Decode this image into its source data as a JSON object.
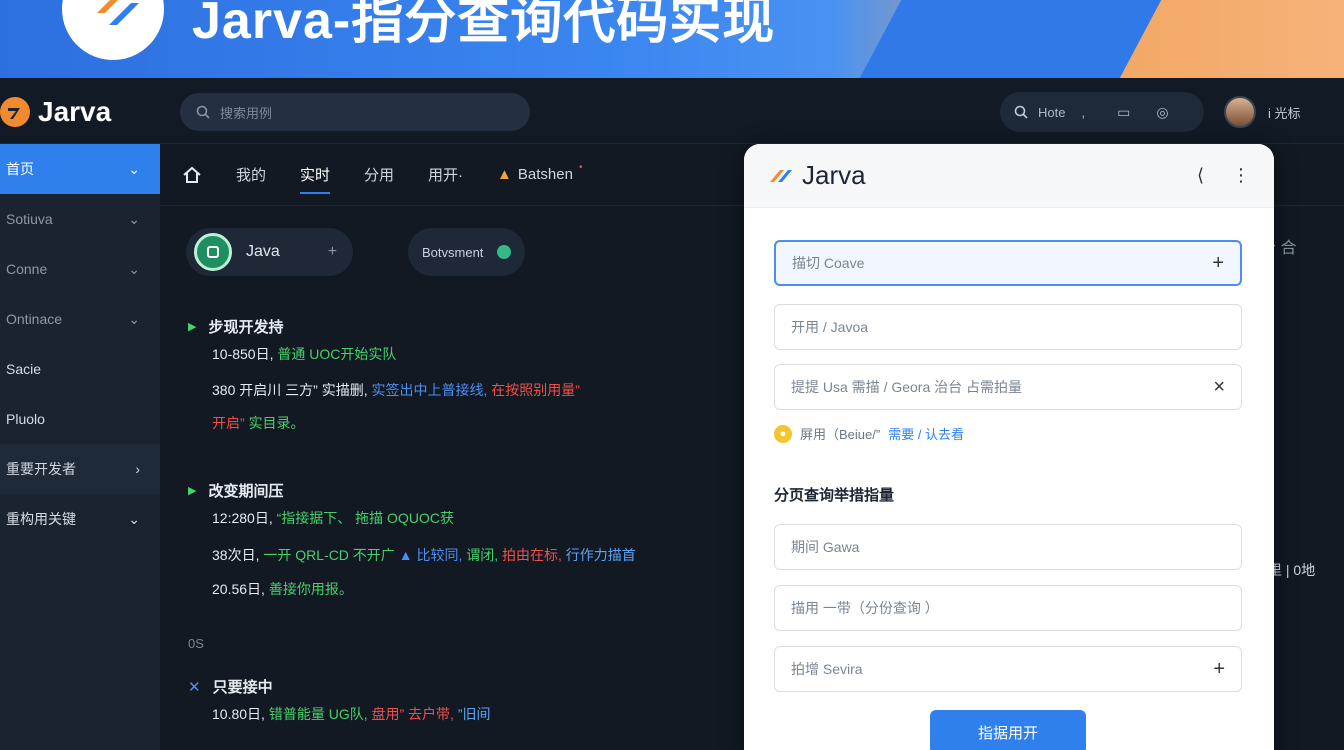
{
  "banner": {
    "title": "Jarva-指分查询代码实现"
  },
  "topbar": {
    "brand": "Jarva",
    "search_placeholder": "搜索用例",
    "pill_label": "Hote",
    "user_name": "i 光标"
  },
  "sidebar": {
    "items": [
      {
        "label": "首页",
        "state": "active"
      },
      {
        "label": "Sotiuva",
        "state": "normal"
      },
      {
        "label": "Conne",
        "state": "normal"
      },
      {
        "label": "Ontinace",
        "state": "normal"
      },
      {
        "label": "Sacie",
        "state": "white"
      },
      {
        "label": "Pluolo",
        "state": "white"
      },
      {
        "label": "重要开发者",
        "state": "strong"
      },
      {
        "label": "重构用关键",
        "state": "white"
      }
    ]
  },
  "tabs": [
    {
      "label": "我的",
      "active": false
    },
    {
      "label": "实时",
      "active": true
    },
    {
      "label": "分用",
      "active": false
    },
    {
      "label": "用开·",
      "active": false
    },
    {
      "label": "Batshen",
      "active": false
    }
  ],
  "chips": {
    "primary_label": "Java",
    "secondary_label": "Botvsment"
  },
  "sections": [
    {
      "title": "步现开发持",
      "lines": [
        [
          {
            "t": "10-850日, ",
            "c": ""
          },
          {
            "t": "普通 UOC开始实队",
            "c": "g"
          }
        ],
        [
          {
            "t": "380 开启川 三方” ",
            "c": ""
          },
          {
            "t": "实描删, ",
            "c": ""
          },
          {
            "t": "实签出中上普接线, ",
            "c": "b"
          },
          {
            "t": "在按照别用量”",
            "c": "r"
          }
        ],
        [
          {
            "t": "开启” ",
            "c": "r"
          },
          {
            "t": "实目录。",
            "c": "g"
          }
        ]
      ]
    },
    {
      "title": "改变期间压",
      "lines": [
        [
          {
            "t": "12:280日, ",
            "c": ""
          },
          {
            "t": "“指接据下、 拖描 OQUOC获",
            "c": "g"
          }
        ],
        [
          {
            "t": "38次日, ",
            "c": ""
          },
          {
            "t": "一开 QRL-CD 不开广 ",
            "c": "g"
          },
          {
            "t": "▲ 比较同, ",
            "c": "b"
          },
          {
            "t": "谓闭, ",
            "c": "g"
          },
          {
            "t": "拍由在标, ",
            "c": "r"
          },
          {
            "t": "行作力描首",
            "c": "lb"
          }
        ],
        [
          {
            "t": "20.56日, ",
            "c": ""
          },
          {
            "t": "善接你用报。",
            "c": "g"
          }
        ]
      ]
    },
    {
      "title": "只要接中",
      "lines": [
        [
          {
            "t": "10.80日, ",
            "c": ""
          },
          {
            "t": "错普能量 UG队, ",
            "c": "g"
          },
          {
            "t": "盘用” 去户带, ",
            "c": "r"
          },
          {
            "t": "”旧间",
            "c": "lb"
          }
        ]
      ]
    }
  ],
  "hash_text": "0S",
  "right_ghost": {
    "icons_text": "合 合",
    "row_text": "里 | 0地"
  },
  "panel": {
    "brand": "Jarva",
    "fields": [
      {
        "text": "描切 Coave",
        "suffix": "+",
        "focused": true
      },
      {
        "text": "开用 / Javoa",
        "suffix": "",
        "focused": false
      },
      {
        "text": "提提 Usa 需描 / Geora 治台 占需拍量",
        "suffix": "×",
        "focused": false
      }
    ],
    "hint_prefix": "屏用（Beiue/”",
    "hint_link": "需要 / 认去看",
    "section_title": "分页查询举措指量",
    "fields2": [
      {
        "text": "期间 Gawa",
        "suffix": ""
      },
      {
        "text": "描用 一带（分份查询 ）",
        "suffix": ""
      },
      {
        "text": "拍增 Sevira",
        "suffix": "+"
      }
    ],
    "primary_button": "指据用开"
  },
  "colors": {
    "accent": "#2f80ed",
    "success": "#46d16b",
    "danger": "#f0504a",
    "bg": "#121922"
  }
}
